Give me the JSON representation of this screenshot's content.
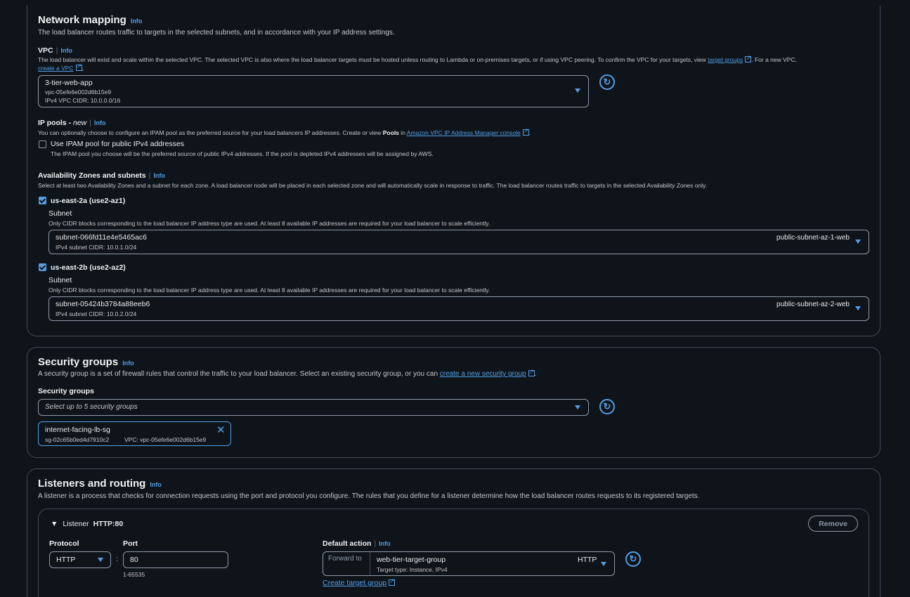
{
  "network": {
    "title": "Network mapping",
    "info": "Info",
    "desc": "The load balancer routes traffic to targets in the selected subnets, and in accordance with your IP address settings.",
    "vpc": {
      "label": "VPC",
      "info": "Info",
      "desc_a": "The load balancer will exist and scale within the selected VPC. The selected VPC is also where the load balancer targets must be hosted unless routing to Lambda or on-premises targets, or if using VPC peering. To confirm the VPC for your targets, view",
      "link_target_groups": "target groups",
      "desc_b": ". For a new VPC,",
      "link_create_vpc": "create a VPC",
      "selected_name": "3-tier-web-app",
      "selected_id": "vpc-05efe6e002d6b15e9",
      "selected_cidr": "IPv4 VPC CIDR: 10.0.0.0/16"
    },
    "ipam": {
      "label": "IP pools - ",
      "label_new": "new",
      "info": "Info",
      "desc_a": "You can optionally choose to configure an IPAM pool as the preferred source for your load balancers IP addresses. Create or view ",
      "desc_bold": "Pools",
      "desc_b": " in ",
      "link": "Amazon VPC IP Address Manager console",
      "desc_c": ".",
      "checkbox_label": "Use IPAM pool for public IPv4 addresses",
      "checkbox_desc": "The IPAM pool you choose will be the preferred source of public IPv4 addresses. If the pool is depleted IPv4 addresses will be assigned by AWS."
    },
    "az": {
      "label": "Availability Zones and subnets",
      "info": "Info",
      "desc": "Select at least two Availability Zones and a subnet for each zone. A load balancer node will be placed in each selected zone and will automatically scale in response to traffic. The load balancer routes traffic to targets in the selected Availability Zones only.",
      "zones": [
        {
          "name": "us-east-2a (use2-az1)",
          "subnet_label": "Subnet",
          "subnet_desc": "Only CIDR blocks corresponding to the load balancer IP address type are used. At least 8 available IP addresses are required for your load balancer to scale efficiently.",
          "subnet_id": "subnet-066fd11e4e5465ac6",
          "subnet_cidr": "IPv4 subnet CIDR: 10.0.1.0/24",
          "subnet_name": "public-subnet-az-1-web"
        },
        {
          "name": "us-east-2b (use2-az2)",
          "subnet_label": "Subnet",
          "subnet_desc": "Only CIDR blocks corresponding to the load balancer IP address type are used. At least 8 available IP addresses are required for your load balancer to scale efficiently.",
          "subnet_id": "subnet-05424b3784a88eeb6",
          "subnet_cidr": "IPv4 subnet CIDR: 10.0.2.0/24",
          "subnet_name": "public-subnet-az-2-web"
        }
      ]
    }
  },
  "security": {
    "title": "Security groups",
    "info": "Info",
    "desc_a": "A security group is a set of firewall rules that control the traffic to your load balancer. Select an existing security group, or you can",
    "link": "create a new security group",
    "desc_b": ".",
    "field_label": "Security groups",
    "placeholder": "Select up to 5 security groups",
    "token_name": "internet-facing-lb-sg",
    "token_id": "sg-02c65b0ed4d7910c2",
    "token_vpc": "VPC: vpc-05efe6e002d6b15e9"
  },
  "listeners": {
    "title": "Listeners and routing",
    "info": "Info",
    "desc": "A listener is a process that checks for connection requests using the port and protocol you configure. The rules that you define for a listener determine how the load balancer routes requests to its registered targets.",
    "listener_label": "Listener",
    "listener_value": "HTTP:80",
    "remove": "Remove",
    "protocol_label": "Protocol",
    "protocol_value": "HTTP",
    "port_label": "Port",
    "port_value": "80",
    "port_hint": "1-65535",
    "colon": ":",
    "default_action_label": "Default action",
    "default_action_info": "Info",
    "forward_to": "Forward to",
    "target_group": "web-tier-target-group",
    "target_type": "Target type: Instance, IPv4",
    "target_protocol": "HTTP",
    "create_target_group": "Create target group"
  }
}
